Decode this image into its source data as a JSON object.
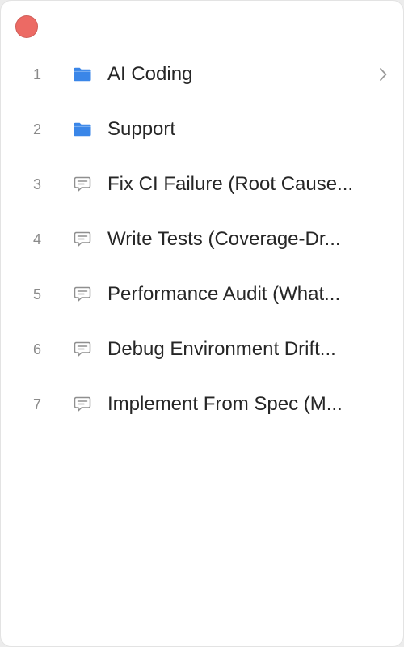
{
  "window": {
    "close_color": "#ec6a64",
    "accent_folder": "#3a86e8"
  },
  "items": [
    {
      "number": "1",
      "label": "AI Coding",
      "icon": "folder-icon",
      "has_children": true
    },
    {
      "number": "2",
      "label": "Support",
      "icon": "folder-icon",
      "has_children": false
    },
    {
      "number": "3",
      "label": "Fix CI Failure (Root Cause...",
      "icon": "chat-bubble-icon",
      "has_children": false
    },
    {
      "number": "4",
      "label": "Write Tests (Coverage-Dr...",
      "icon": "chat-bubble-icon",
      "has_children": false
    },
    {
      "number": "5",
      "label": "Performance Audit (What...",
      "icon": "chat-bubble-icon",
      "has_children": false
    },
    {
      "number": "6",
      "label": "Debug Environment Drift...",
      "icon": "chat-bubble-icon",
      "has_children": false
    },
    {
      "number": "7",
      "label": "Implement From Spec (M...",
      "icon": "chat-bubble-icon",
      "has_children": false
    }
  ]
}
